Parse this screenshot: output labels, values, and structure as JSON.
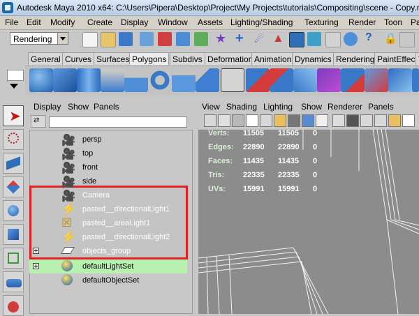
{
  "window": {
    "title": "Autodesk Maya 2010 x64: C:\\Users\\Pipera\\Desktop\\Project\\My Projects\\tutorials\\Compositing\\scene - Copy.ma*"
  },
  "menubar": {
    "items": [
      "File",
      "Edit",
      "Modify",
      "Create",
      "Display",
      "Window",
      "Assets",
      "Lighting/Shading",
      "Texturing",
      "Render",
      "Toon",
      "Pa"
    ]
  },
  "statusline": {
    "mode_value": "Rendering"
  },
  "shelf": {
    "tabs": [
      "General",
      "Curves",
      "Surfaces",
      "Polygons",
      "Subdivs",
      "Deformation",
      "Animation",
      "Dynamics",
      "Rendering",
      "PaintEffects",
      "T"
    ],
    "active_tab": "Polygons"
  },
  "outliner": {
    "menu": [
      "Display",
      "Show",
      "Panels"
    ],
    "search_value": "",
    "items": [
      {
        "label": "persp",
        "icon": "camera-icon"
      },
      {
        "label": "top",
        "icon": "camera-icon"
      },
      {
        "label": "front",
        "icon": "camera-icon"
      },
      {
        "label": "side",
        "icon": "camera-icon"
      },
      {
        "label": "Camera",
        "icon": "camera-icon"
      },
      {
        "label": "pasted__directionalLight1",
        "icon": "directional-light-icon"
      },
      {
        "label": "pasted__areaLight1",
        "icon": "area-light-icon"
      },
      {
        "label": "pasted__directionalLight2",
        "icon": "directional-light-icon"
      },
      {
        "label": "objects_group",
        "icon": "group-icon"
      },
      {
        "label": "defaultLightSet",
        "icon": "set-icon"
      },
      {
        "label": "defaultObjectSet",
        "icon": "set-icon"
      }
    ],
    "highlight_color": "#e02020",
    "set_highlight_color": "#b8f0b0"
  },
  "viewport": {
    "menu": [
      "View",
      "Shading",
      "Lighting",
      "Show",
      "Renderer",
      "Panels"
    ],
    "hud": [
      {
        "label": "Verts:",
        "values": [
          "11505",
          "11505",
          "0"
        ]
      },
      {
        "label": "Edges:",
        "values": [
          "22890",
          "22890",
          "0"
        ]
      },
      {
        "label": "Faces:",
        "values": [
          "11435",
          "11435",
          "0"
        ]
      },
      {
        "label": "Tris:",
        "values": [
          "22335",
          "22335",
          "0"
        ]
      },
      {
        "label": "UVs:",
        "values": [
          "15991",
          "15991",
          "0"
        ]
      }
    ]
  }
}
